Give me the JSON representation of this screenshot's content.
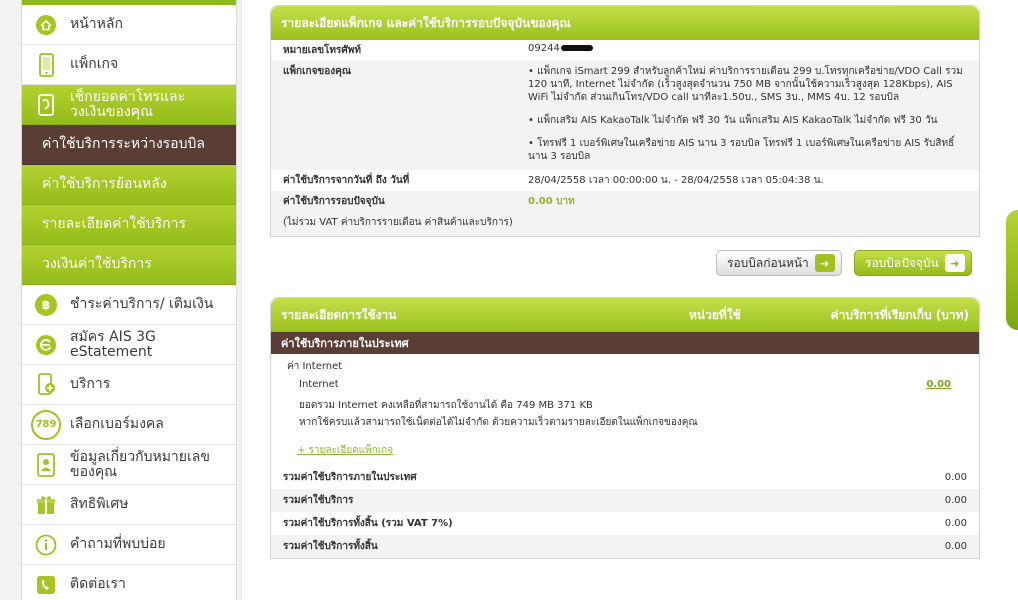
{
  "sidebar": {
    "items": [
      {
        "label": "หน้าหลัก",
        "icon": "home-icon"
      },
      {
        "label": "แพ็กเกจ",
        "icon": "phone-icon"
      },
      {
        "label": "เช็กยอดค่าโทรและวงเงินของคุณ",
        "icon": "bill-icon"
      },
      {
        "label": "ค่าใช้บริการระหว่างรอบบิล"
      },
      {
        "label": "ค่าใช้บริการย้อนหลัง"
      },
      {
        "label": "รายละเอียดค่าใช้บริการ"
      },
      {
        "label": "วงเงินค่าใช้บริการ"
      },
      {
        "label": "ชำระค่าบริการ/ เติมเงิน",
        "icon": "baht-icon"
      },
      {
        "label": "สมัคร AIS 3G eStatement",
        "icon": "estatement-icon"
      },
      {
        "label": "บริการ",
        "icon": "service-icon"
      },
      {
        "label": "เลือกเบอร์มงคล",
        "icon": "lucky-number-icon",
        "icon_text": "789"
      },
      {
        "label": "ข้อมูลเกี่ยวกับหมายเลขของคุณ",
        "icon": "user-info-icon"
      },
      {
        "label": "สิทธิพิเศษ",
        "icon": "gift-icon"
      },
      {
        "label": "คำถามที่พบบ่อย",
        "icon": "info-icon"
      },
      {
        "label": "ติดต่อเรา",
        "icon": "contact-icon"
      }
    ]
  },
  "summary": {
    "title": "รายละเอียดแพ็กเกจ และค่าใช้บริการรอบปัจจุบันของคุณ",
    "phone_label": "หมายเลขโทรศัพท์",
    "phone_value": "09244",
    "package_label": "แพ็กเกจของคุณ",
    "packages": [
      "• แพ็กเกจ iSmart 299 สำหรับลูกค้าใหม่ ค่าบริการรายเดือน 299 บ.โทรทุกเครือข่าย/VDO Call รวม 120 นาที, Internet ไม่จำกัด (เร็วสูงสุดจำนวน 750 MB จากนั้นใช้ความเร็วสูงสุด 128Kbps), AIS WiFi ไม่จำกัด ส่วนเกินโทร/VDO call นาทีละ1.50บ., SMS 3บ., MMS 4บ. 12 รอบบิล",
      "• แพ็กเสริม AIS KakaoTalk ไม่จำกัด ฟรี 30 วัน แพ็กเสริม AIS KakaoTalk ไม่จำกัด ฟรี 30 วัน",
      "• โทรฟรี 1 เบอร์พิเศษในเครือข่าย AIS นาน 3 รอบบิล โทรฟรี 1 เบอร์พิเศษในเครือข่าย AIS รับสิทธิ์นาน 3 รอบบิล"
    ],
    "period_label": "ค่าใช้บริการจากวันที่ ถึง วันที่",
    "period_value": "28/04/2558 เวลา 00:00:00 น. - 28/04/2558 เวลา 05:04:38 น.",
    "current_label": "ค่าใช้บริการรอบปัจจุบัน",
    "current_value": "0.00 บาท",
    "vat_note": "(ไม่รวม VAT ค่าบริการรายเดือน ค่าสินค้าและบริการ)"
  },
  "buttons": {
    "prev": "รอบบิลก่อนหน้า",
    "current": "รอบบิลปัจจุบัน"
  },
  "usage": {
    "col_item": "รายละเอียดการใช้งาน",
    "col_unit": "หน่วยที่ใช้",
    "col_charge": "ค่าบริการที่เรียกเก็บ (บาท)",
    "section": "ค่าใช้บริการภายในประเทศ",
    "subsection": "ค่า Internet",
    "line_name": "Internet",
    "line_value": "0.00",
    "note1": "ยอดรวม Internet คงเหลือที่สามารถใช้งานได้ คือ 749 MB 371 KB",
    "note2": "หากใช้ครบแล้วสามารถใช้เน็ตต่อได้ไม่จำกัด ด้วยความเร็วตามรายละเอียดในแพ็กเกจของคุณ",
    "detail_link": "+ รายละเอียดแพ็กเกจ",
    "totals": [
      {
        "label": "รวมค่าใช้บริการภายในประเทศ",
        "value": "0.00"
      },
      {
        "label": "รวมค่าใช้บริการ",
        "value": "0.00"
      },
      {
        "label": "รวมค่าใช้บริการทั้งสิ้น (รวม VAT 7%)",
        "value": "0.00"
      },
      {
        "label": "รวมค่าใช้บริการทั้งสิ้น",
        "value": "0.00"
      }
    ]
  },
  "colors": {
    "accent_green": "#9ec21f",
    "dark_brown": "#5a3d34"
  }
}
